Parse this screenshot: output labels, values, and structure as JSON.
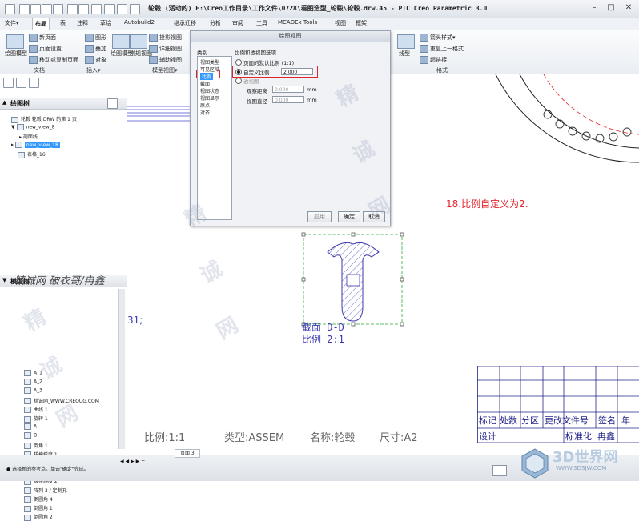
{
  "window": {
    "title": "轮毂 (活动的) E:\\Creo工作目录\\工作文件\\0728\\看图造型_轮毂\\轮毂.drw.45 - PTC Creo Parametric 3.0",
    "minimize": "–",
    "maximize": "□",
    "close": "✕"
  },
  "menu_tabs": [
    "文件▾",
    "布局",
    "表",
    "注释",
    "草绘",
    "Autobuild2",
    "继承迁移",
    "分析",
    "审阅",
    "工具",
    "MCADEx Tools",
    "视图",
    "框架"
  ],
  "ribbon": {
    "doc_group": {
      "label": "文档",
      "buttons": [
        "新页面",
        "页面设置",
        "移动或复制页面",
        "绘图模型"
      ]
    },
    "insert_group": {
      "label": "插入▾",
      "buttons": [
        "图形",
        "叠加",
        "对象"
      ]
    },
    "model_views_group": {
      "label": "模型视图▾",
      "buttons": [
        "投影视图",
        "详细视图",
        "辅助视图",
        "常规视图",
        "绘图模型"
      ]
    },
    "format_group": {
      "label": "格式",
      "buttons": [
        "箭头样式▾",
        "重复上一格式",
        "超链接",
        "线型"
      ]
    }
  },
  "left_panel": {
    "drawing_tree_title": "绘图树",
    "drawing_tree": [
      "轮毂 轮毂 DRW 的第 1 页",
      "new_view_8",
      "剖面线",
      "new_view_18",
      "表格_16"
    ],
    "model_tree_title": "模型树",
    "model_tree": [
      "A_1",
      "A_2",
      "A_3",
      "精诚网_WWW.CREOUG.COM",
      "曲线 1",
      "旋转 1",
      "A",
      "B",
      "倒角 1",
      "拔模斜度 1",
      "阵列 2 / 定制孔",
      "阵列 1",
      "拔模斜度 2",
      "阵列 3 / 定制孔",
      "倒圆角 4",
      "倒圆角 1",
      "倒圆角 2"
    ]
  },
  "dialog": {
    "title": "绘图视图",
    "category_label": "类别",
    "categories": [
      "视图类型",
      "可见区域",
      "比例",
      "截面",
      "视图状态",
      "视图显示",
      "原点",
      "对齐"
    ],
    "section_title": "比例和透视图选项",
    "option_default": "页面的默认比例 (1:1)",
    "option_custom": "自定义比例",
    "custom_value": "2.000",
    "option_perspective": "透视图",
    "viewing_distance_label": "观察距离",
    "viewing_distance_value": "0.000",
    "view_diameter_label": "视图直径",
    "view_diameter_value": "0.000",
    "unit": "mm",
    "apply": "应用",
    "ok": "确定",
    "cancel": "取消"
  },
  "annotation": {
    "text": "18.比例自定义为2.",
    "color": "#e0242b"
  },
  "section_view": {
    "line1": "截面  D-D",
    "line2": "比例  2:1"
  },
  "partial_text": "31;",
  "watermark_label": "精诚网 破衣哥/冉鑫",
  "title_block": {
    "row1": [
      "标记",
      "处数",
      "分区",
      "更改文件号",
      "签名",
      "年"
    ],
    "row2": [
      "设计",
      "",
      "",
      "标准化",
      "冉鑫"
    ]
  },
  "bottom_info": {
    "scale": "比例:1:1",
    "type": "类型:ASSEM",
    "name": "名称:轮毂",
    "size": "尺寸:A2"
  },
  "status_bar": {
    "message": "● 选择新的参考点。单击\"确定\"完成。",
    "page_tab": "页面 3",
    "brand": "3D世界网",
    "brand_url": "WWW.3DSJW.COM"
  },
  "watermark_chars": [
    "精",
    "诚",
    "网",
    "精",
    "诚",
    "网",
    "精",
    "诚",
    "网"
  ]
}
